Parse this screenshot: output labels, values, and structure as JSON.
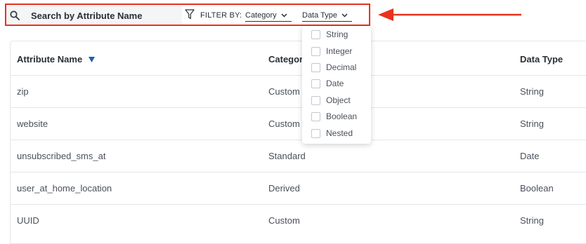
{
  "search": {
    "placeholder": "Search by Attribute Name",
    "icon": "search-icon"
  },
  "filters": {
    "label": "FILTER BY:",
    "category_label": "Category",
    "data_type_label": "Data Type"
  },
  "annotation": {
    "color": "#e8321e"
  },
  "table": {
    "columns": [
      "Attribute Name",
      "Category",
      "Data Type"
    ],
    "sort_indicator": "sort-desc-icon",
    "rows": [
      {
        "name": "zip",
        "category": "Custom",
        "data_type": "String"
      },
      {
        "name": "website",
        "category": "Custom",
        "data_type": "String"
      },
      {
        "name": "unsubscribed_sms_at",
        "category": "Standard",
        "data_type": "Date"
      },
      {
        "name": "user_at_home_location",
        "category": "Derived",
        "data_type": "Boolean"
      },
      {
        "name": "UUID",
        "category": "Custom",
        "data_type": "String"
      }
    ]
  },
  "data_type_menu": {
    "options": [
      "String",
      "Integer",
      "Decimal",
      "Date",
      "Object",
      "Boolean",
      "Nested"
    ]
  }
}
